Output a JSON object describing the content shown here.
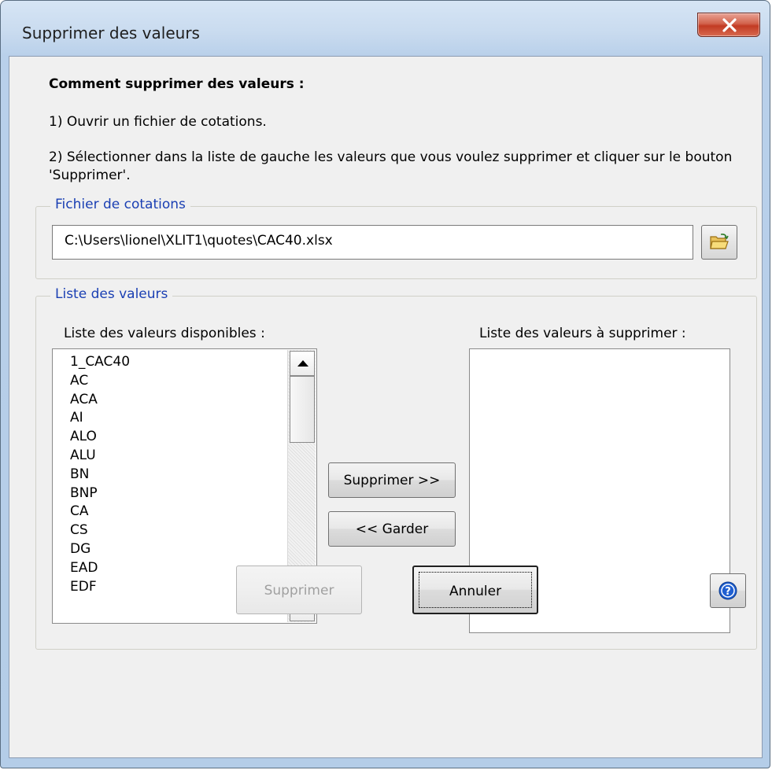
{
  "window": {
    "title": "Supprimer des valeurs"
  },
  "instructions": {
    "heading": "Comment supprimer des valeurs :",
    "step1": "1) Ouvrir un fichier de cotations.",
    "step2": "2) Sélectionner dans la liste de gauche les valeurs que vous voulez supprimer et cliquer sur le bouton 'Supprimer'."
  },
  "file_group": {
    "label": "Fichier de cotations",
    "path": "C:\\Users\\lionel\\XLIT1\\quotes\\CAC40.xlsx",
    "browse_icon": "folder-open-icon"
  },
  "values_group": {
    "label": "Liste des valeurs",
    "available_label": "Liste des valeurs disponibles :",
    "to_delete_label": "Liste des valeurs à supprimer :",
    "available_items": [
      "1_CAC40",
      "AC",
      "ACA",
      "AI",
      "ALO",
      "ALU",
      "BN",
      "BNP",
      "CA",
      "CS",
      "DG",
      "EAD",
      "EDF"
    ],
    "to_delete_items": [],
    "move_right_label": "Supprimer >>",
    "move_left_label": "<< Garder"
  },
  "footer": {
    "delete_label": "Supprimer",
    "delete_enabled": false,
    "cancel_label": "Annuler",
    "help_icon": "help-icon"
  },
  "colors": {
    "group_label": "#1a3fb3",
    "close_button": "#c23b23",
    "disabled_text": "#a0a0a0"
  }
}
